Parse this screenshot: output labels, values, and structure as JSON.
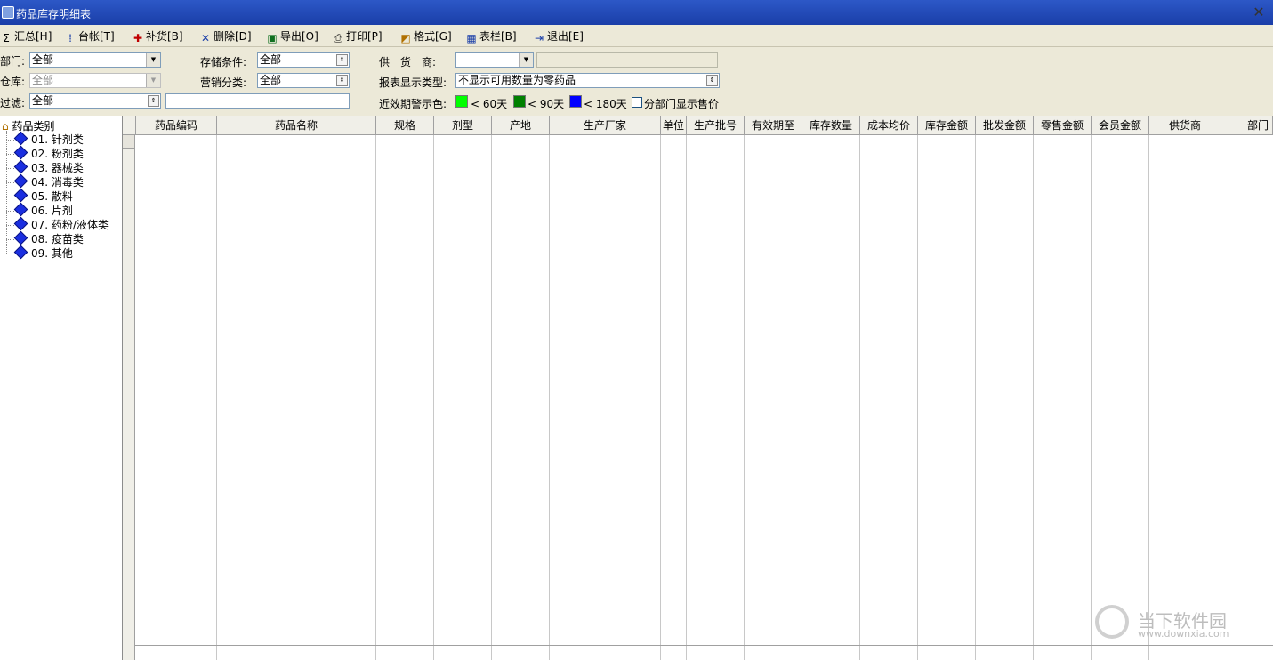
{
  "window": {
    "title": "药品库存明细表",
    "close_symbol": "✕"
  },
  "toolbar": [
    {
      "id": "summary",
      "label": "汇总[H]",
      "icon": "sigma-icon",
      "glyph": "Σ"
    },
    {
      "id": "ledger",
      "label": "台帐[T]",
      "icon": "ledger-icon",
      "glyph": "⁞"
    },
    {
      "id": "restock",
      "label": "补货[B]",
      "icon": "restock-icon",
      "glyph": "✚"
    },
    {
      "id": "delete",
      "label": "删除[D]",
      "icon": "delete-icon",
      "glyph": "✕"
    },
    {
      "id": "export",
      "label": "导出[O]",
      "icon": "excel-icon",
      "glyph": "▣"
    },
    {
      "id": "print",
      "label": "打印[P]",
      "icon": "printer-icon",
      "glyph": "⎙"
    },
    {
      "id": "format",
      "label": "格式[G]",
      "icon": "format-icon",
      "glyph": "◩"
    },
    {
      "id": "columns",
      "label": "表栏[B]",
      "icon": "columns-icon",
      "glyph": "▦"
    },
    {
      "id": "exit",
      "label": "退出[E]",
      "icon": "exit-icon",
      "glyph": "⇥"
    }
  ],
  "filters": {
    "dept": {
      "label": "部门:",
      "value": "全部"
    },
    "warehouse": {
      "label": "仓库:",
      "value": "全部"
    },
    "filter": {
      "label": "过滤:",
      "value": "全部"
    },
    "storage": {
      "label": "存储条件:",
      "value": "全部"
    },
    "marketing": {
      "label": "营销分类:",
      "value": "全部"
    },
    "supplier": {
      "label": "供　货　商:",
      "value": ""
    },
    "report_type": {
      "label": "报表显示类型:",
      "value": "不显示可用数量为零药品"
    },
    "expiry": {
      "label": "近效期警示色:",
      "levels": [
        {
          "label": "< 60天",
          "color": "#00ff00"
        },
        {
          "label": "< 90天",
          "color": "#008000"
        },
        {
          "label": "< 180天",
          "color": "#0000ff"
        }
      ]
    },
    "dept_price": {
      "label": "分部门显示售价",
      "checked": false
    }
  },
  "tree": {
    "root": "药品类别",
    "items": [
      "01. 针剂类",
      "02. 粉剂类",
      "03. 器械类",
      "04. 消毒类",
      "05. 散料",
      "06. 片剂",
      "07. 药粉/液体类",
      "08. 疫苗类",
      "09. 其他"
    ]
  },
  "grid": {
    "columns": [
      "药品编码",
      "药品名称",
      "规格",
      "剂型",
      "产地",
      "生产厂家",
      "单位",
      "生产批号",
      "有效期至",
      "库存数量",
      "成本均价",
      "库存金额",
      "批发金额",
      "零售金额",
      "会员金额",
      "供货商",
      "部门"
    ]
  },
  "watermark": {
    "name": "当下软件园",
    "url": "www.downxia.com"
  }
}
